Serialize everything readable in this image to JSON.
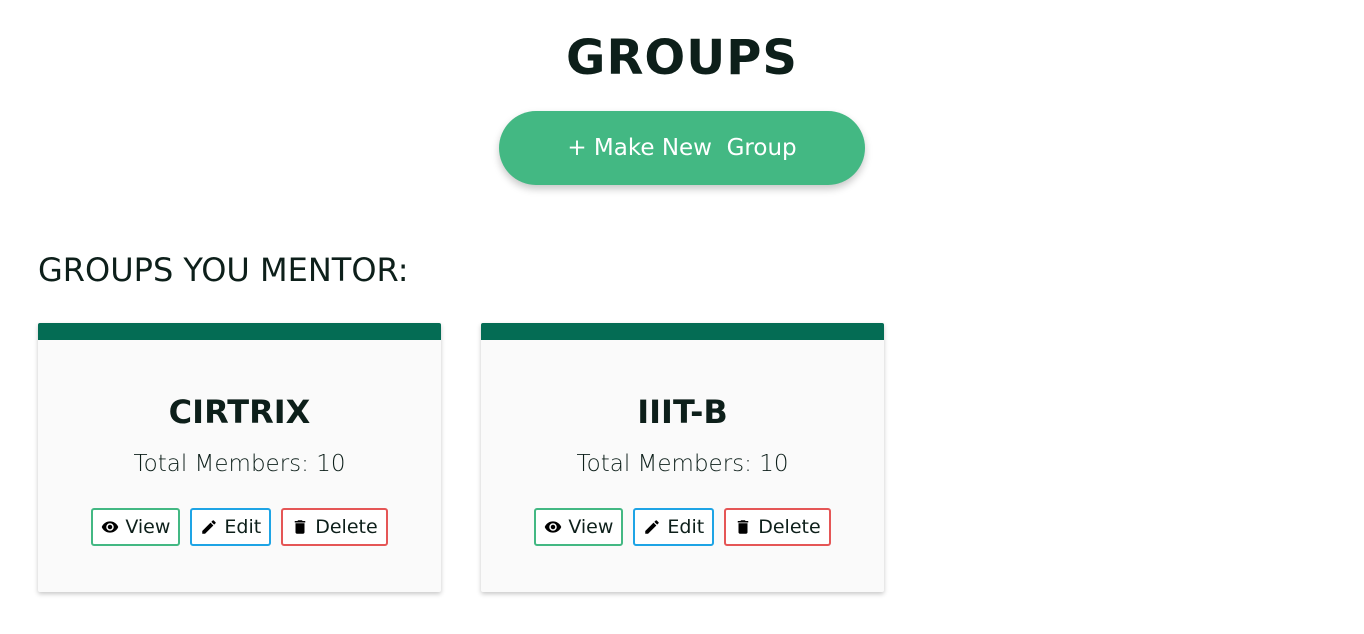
{
  "header": {
    "title": "GROUPS",
    "new_group_label": "+ Make New  Group"
  },
  "section": {
    "title": "GROUPS YOU MENTOR:"
  },
  "cards": [
    {
      "name": "CIRTRIX",
      "members": "Total Members: 10",
      "view_label": "View",
      "edit_label": "Edit",
      "delete_label": "Delete"
    },
    {
      "name": "IIIT-B",
      "members": "Total Members: 10",
      "view_label": "View",
      "edit_label": "Edit",
      "delete_label": "Delete"
    }
  ],
  "icons": {
    "view": "eye-icon",
    "edit": "pencil-icon",
    "delete": "trash-icon"
  },
  "colors": {
    "accent": "#43b883",
    "card_header": "#046c54",
    "view_border": "#43b883",
    "edit_border": "#1ea4e5",
    "delete_border": "#e55656"
  }
}
